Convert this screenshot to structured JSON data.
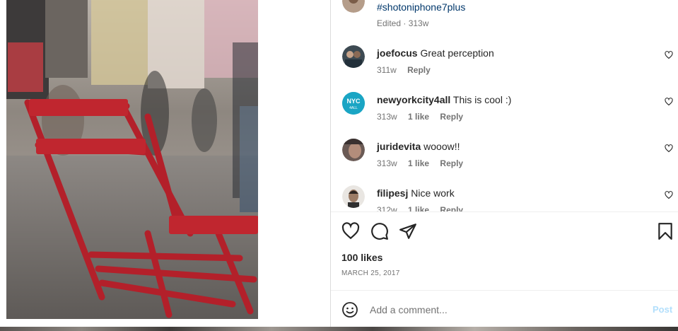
{
  "caption": {
    "hashtag": "#shotoniphone7plus",
    "edited": "Edited · 313w"
  },
  "comments": [
    {
      "username": "joefocus",
      "text": "Great perception",
      "time": "311w",
      "likes": "",
      "reply": "Reply"
    },
    {
      "username": "newyorkcity4all",
      "text": "This is cool :)",
      "time": "313w",
      "likes": "1 like",
      "reply": "Reply",
      "avatar_text": [
        "NYC",
        "4ALL"
      ]
    },
    {
      "username": "juridevita",
      "text": "wooow!!",
      "time": "313w",
      "likes": "1 like",
      "reply": "Reply"
    },
    {
      "username": "filipesj",
      "text": "Nice work",
      "time": "312w",
      "likes": "1 like",
      "reply": "Reply"
    }
  ],
  "actions": {
    "like_icon": "heart-icon",
    "comment_icon": "comment-icon",
    "share_icon": "share-icon",
    "save_icon": "bookmark-icon"
  },
  "likes_count": "100 likes",
  "post_date": "MARCH 25, 2017",
  "add_comment": {
    "placeholder": "Add a comment...",
    "emoji_icon": "emoji-icon",
    "post_label": "Post"
  },
  "colors": {
    "link": "#00376b",
    "secondary_text": "#737373",
    "post_disabled": "#b2dffc",
    "nyc_avatar": "#1aa5c4",
    "chair_red": "#b3202a"
  }
}
